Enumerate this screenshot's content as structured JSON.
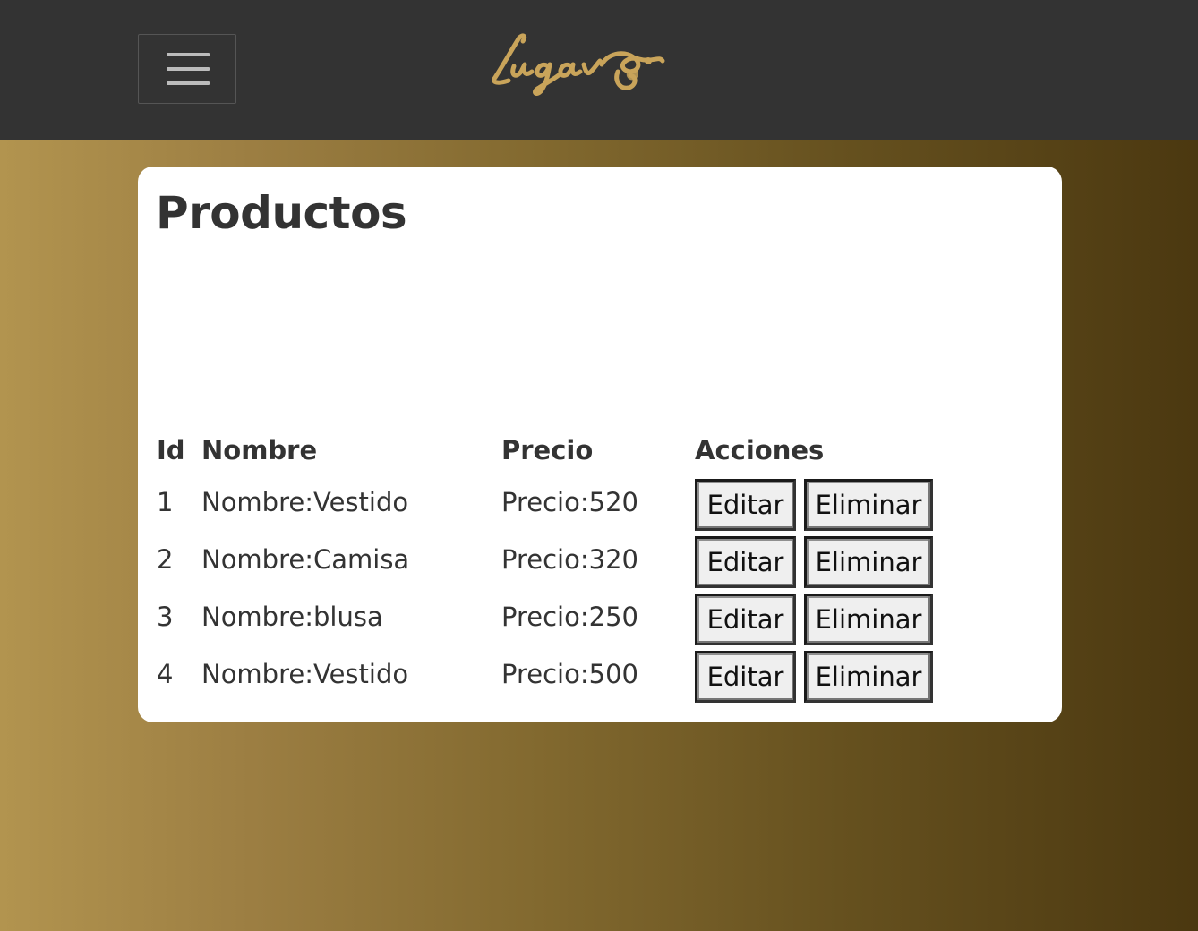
{
  "nav": {
    "menu_toggle": "menu-toggle",
    "logo_text": "Lugaves",
    "background": "#333333",
    "logo_color": "#c9a45a"
  },
  "page": {
    "title": "Productos"
  },
  "table": {
    "headers": [
      "Id",
      "Nombre",
      "Precio",
      "Acciones"
    ],
    "rows": [
      {
        "id": "1",
        "nombre": "Nombre:Vestido",
        "precio": "Precio:520",
        "edit": "Editar",
        "delete": "Eliminar"
      },
      {
        "id": "2",
        "nombre": "Nombre:Camisa",
        "precio": "Precio:320",
        "edit": "Editar",
        "delete": "Eliminar"
      },
      {
        "id": "3",
        "nombre": "Nombre:blusa",
        "precio": "Precio:250",
        "edit": "Editar",
        "delete": "Eliminar"
      },
      {
        "id": "4",
        "nombre": "Nombre:Vestido",
        "precio": "Precio:500",
        "edit": "Editar",
        "delete": "Eliminar"
      }
    ]
  }
}
